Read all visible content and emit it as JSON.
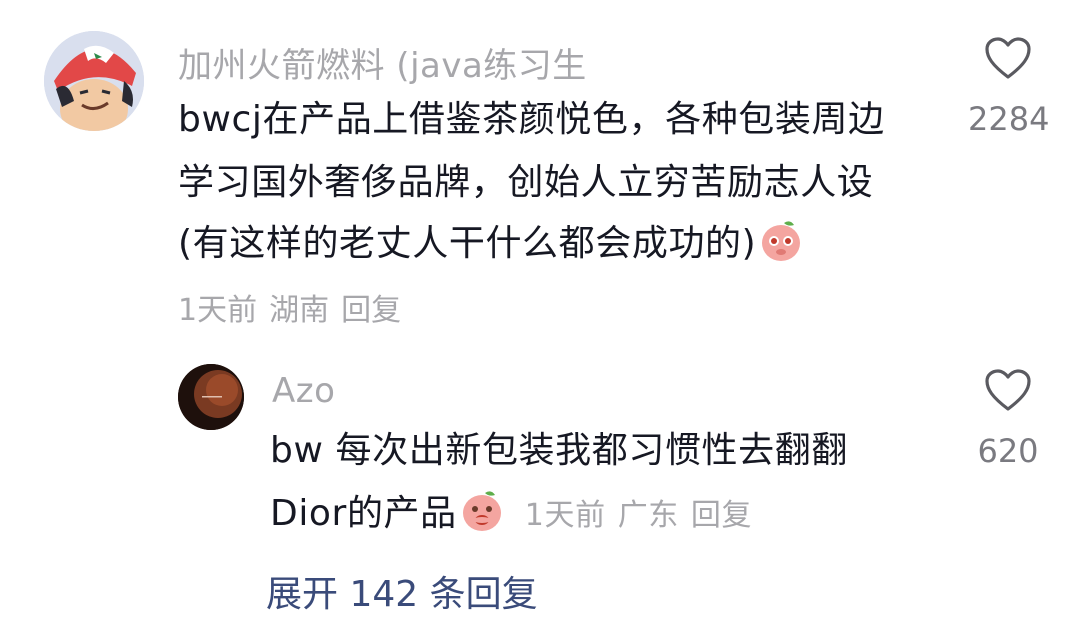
{
  "comment": {
    "username": "加州火箭燃料 (java练习生",
    "lines": [
      "bwcj在产品上借鉴茶颜悦色，各种包装周边",
      "学习国外奢侈品牌，创始人立穷苦励志人设",
      "(有这样的老丈人干什么都会成功的)"
    ],
    "time": "1天前",
    "location": "湖南",
    "reply_label": "回复",
    "like_count": "2284",
    "emoji_icon": "peach-face-emoji"
  },
  "reply": {
    "username": "Azo",
    "lines": [
      "bw 每次出新包装我都习惯性去翻翻",
      "Dior的产品"
    ],
    "time": "1天前",
    "location": "广东",
    "reply_label": "回复",
    "like_count": "620",
    "emoji_icon": "peach-face-emoji"
  },
  "expand_replies": "展开 142 条回复",
  "colors": {
    "text": "#161823",
    "secondary": "#a7a7ab",
    "link": "#3a4b7a"
  }
}
